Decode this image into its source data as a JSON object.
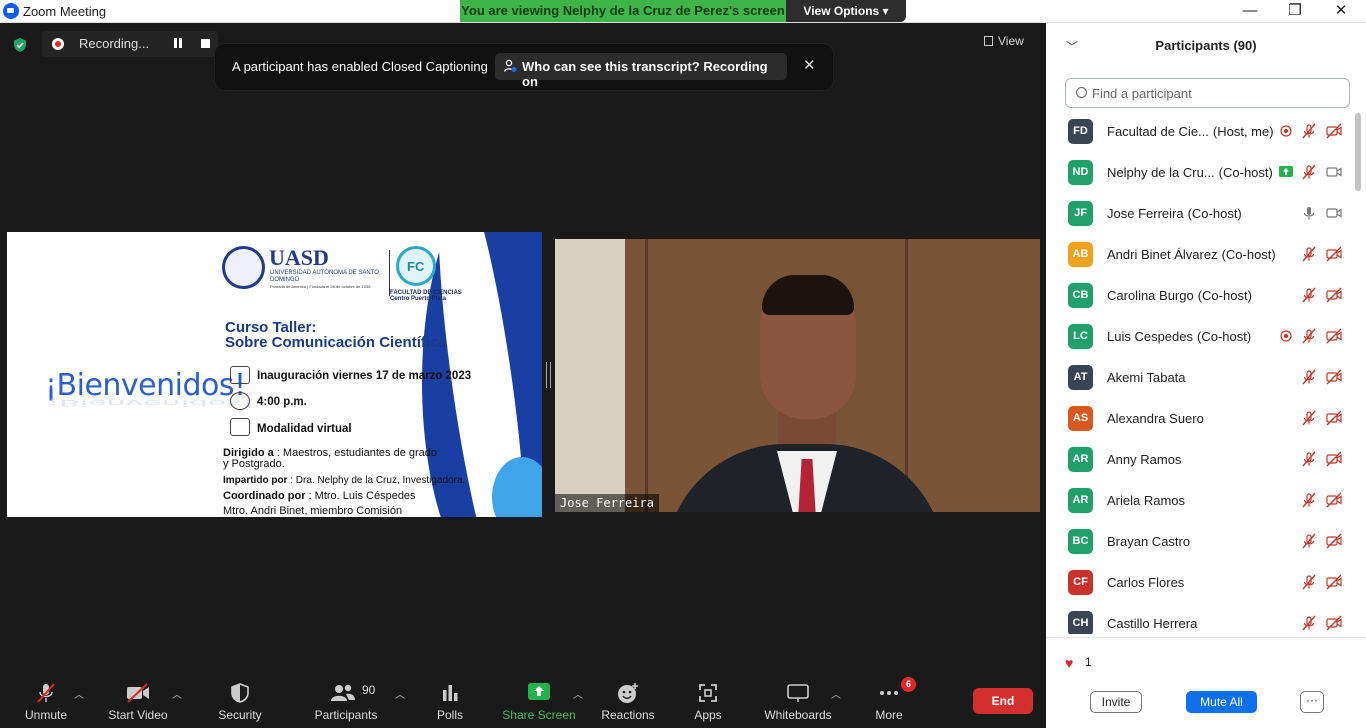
{
  "window": {
    "title": "Zoom Meeting",
    "viewing_banner": "You are viewing Nelphy de la Cruz de Perez's screen",
    "view_options": "View Options"
  },
  "meeting": {
    "recording_label": "Recording...",
    "view_label": "View",
    "cc_message": "A participant has enabled Closed Captioning",
    "cc_question": "Who can see this transcript? Recording on",
    "video_name": "Jose Ferreira"
  },
  "slide": {
    "welcome": "¡Bienvenidos!",
    "university": "UASD",
    "university_full": "UNIVERSIDAD AUTÓNOMA DE SANTO DOMINGO",
    "university_tiny": "Primada de América | Fundada el 28 de octubre de 1538",
    "faculty": "FACULTAD DE CIENCIAS",
    "faculty_center": "Centro Puerto Plata",
    "course_line1": "Curso Taller:",
    "course_line2": "Sobre Comunicación Científica",
    "inauguration": "Inauguración viernes 17 de marzo  2023",
    "time": "4:00 p.m.",
    "modality": "Modalidad virtual",
    "directed_label": "Dirigido a",
    "directed_text": ": Maestros, estudiantes de grado",
    "directed_text2": "y Postgrado.",
    "taught_label": "Impartido por",
    "taught_text": ": Dra. Nelphy de la Cruz, Investigadora.",
    "coord_label": "Coordinado por",
    "coord_text": ": Mtro. Luis Céspedes",
    "coord_text2": "Mtro. Andri Binet, miembro Comisión"
  },
  "toolbar": {
    "unmute": "Unmute",
    "start_video": "Start Video",
    "security": "Security",
    "participants": "Participants",
    "participants_count": "90",
    "polls": "Polls",
    "share_screen": "Share Screen",
    "reactions": "Reactions",
    "apps": "Apps",
    "whiteboards": "Whiteboards",
    "more": "More",
    "more_badge": "6",
    "end": "End"
  },
  "panel": {
    "title": "Participants (90)",
    "search_placeholder": "Find a participant",
    "participants": [
      {
        "initials": "FD",
        "name": "Facultad de Cie...",
        "role": "(Host, me)",
        "color": "#3a4553",
        "extra": "recording",
        "mic": "muted",
        "video": "off"
      },
      {
        "initials": "ND",
        "name": "Nelphy de la Cru...",
        "role": "(Co-host)",
        "color": "#22a06b",
        "extra": "sharing",
        "mic": "muted",
        "video": "on"
      },
      {
        "initials": "JF",
        "name": "Jose Ferreira",
        "role": "(Co-host)",
        "color": "#22a06b",
        "extra": "",
        "mic": "on",
        "video": "on"
      },
      {
        "initials": "AB",
        "name": "Andri Binet Álvarez",
        "role": "(Co-host)",
        "color": "#f0a21e",
        "extra": "",
        "mic": "muted",
        "video": "off"
      },
      {
        "initials": "CB",
        "name": "Carolina Burgo",
        "role": "(Co-host)",
        "color": "#22a06b",
        "extra": "",
        "mic": "muted",
        "video": "off"
      },
      {
        "initials": "LC",
        "name": "Luis Cespedes",
        "role": "(Co-host)",
        "color": "#22a06b",
        "extra": "recording",
        "mic": "muted",
        "video": "off"
      },
      {
        "initials": "AT",
        "name": "Akemi Tabata",
        "role": "",
        "color": "#3a4553",
        "extra": "",
        "mic": "muted",
        "video": "off"
      },
      {
        "initials": "AS",
        "name": "Alexandra Suero",
        "role": "",
        "color": "#d9581f",
        "extra": "",
        "mic": "muted",
        "video": "off"
      },
      {
        "initials": "AR",
        "name": "Anny Ramos",
        "role": "",
        "color": "#22a06b",
        "extra": "",
        "mic": "muted",
        "video": "off"
      },
      {
        "initials": "AR",
        "name": "Ariela Ramos",
        "role": "",
        "color": "#22a06b",
        "extra": "",
        "mic": "muted",
        "video": "off"
      },
      {
        "initials": "BC",
        "name": "Brayan Castro",
        "role": "",
        "color": "#22a06b",
        "extra": "",
        "mic": "muted",
        "video": "off"
      },
      {
        "initials": "CF",
        "name": "Carlos Flores",
        "role": "",
        "color": "#c8322d",
        "extra": "",
        "mic": "muted",
        "video": "off"
      },
      {
        "initials": "CH",
        "name": "Castillo Herrera",
        "role": "",
        "color": "#3a4553",
        "extra": "",
        "mic": "muted",
        "video": "off"
      }
    ],
    "reaction_count": "1",
    "invite": "Invite",
    "mute_all": "Mute All",
    "more": "···"
  }
}
